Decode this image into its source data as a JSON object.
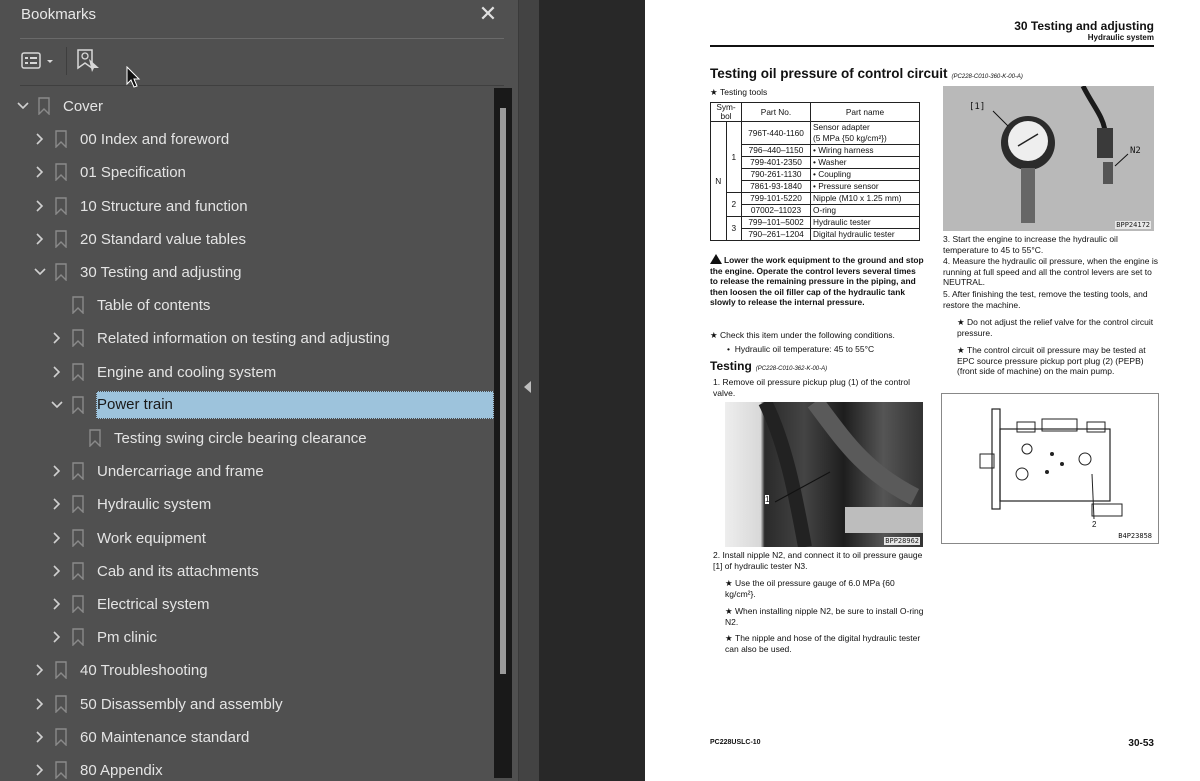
{
  "sidebar": {
    "title": "Bookmarks",
    "close_label": "✕",
    "toolbar": {
      "options_icon": "list-options-icon",
      "find_icon": "find-current-bookmark-icon"
    },
    "items": [
      {
        "label": "Cover",
        "level": 0,
        "state": "expanded"
      },
      {
        "label": "00 Index and foreword",
        "level": 1,
        "state": "collapsed"
      },
      {
        "label": "01 Specification",
        "level": 1,
        "state": "collapsed"
      },
      {
        "label": "10 Structure and function",
        "level": 1,
        "state": "collapsed"
      },
      {
        "label": "20 Standard value tables",
        "level": 1,
        "state": "collapsed"
      },
      {
        "label": "30 Testing and adjusting",
        "level": 1,
        "state": "expanded"
      },
      {
        "label": "Table of contents",
        "level": 2,
        "state": "leaf"
      },
      {
        "label": "Related information on testing and adjusting",
        "level": 2,
        "state": "collapsed"
      },
      {
        "label": "Engine and cooling system",
        "level": 2,
        "state": "collapsed"
      },
      {
        "label": "Power train",
        "level": 2,
        "state": "expanded",
        "selected": true
      },
      {
        "label": "Testing swing circle bearing clearance",
        "level": 3,
        "state": "leaf"
      },
      {
        "label": "Undercarriage and frame",
        "level": 2,
        "state": "collapsed"
      },
      {
        "label": "Hydraulic system",
        "level": 2,
        "state": "collapsed"
      },
      {
        "label": "Work equipment",
        "level": 2,
        "state": "collapsed"
      },
      {
        "label": "Cab and its attachments",
        "level": 2,
        "state": "collapsed"
      },
      {
        "label": "Electrical system",
        "level": 2,
        "state": "collapsed"
      },
      {
        "label": "Pm clinic",
        "level": 2,
        "state": "collapsed"
      },
      {
        "label": "40 Troubleshooting",
        "level": 1,
        "state": "collapsed"
      },
      {
        "label": "50 Disassembly and assembly",
        "level": 1,
        "state": "collapsed"
      },
      {
        "label": "60 Maintenance standard",
        "level": 1,
        "state": "collapsed"
      },
      {
        "label": "80 Appendix",
        "level": 1,
        "state": "collapsed"
      }
    ],
    "selected_color": "#9dc3dc"
  },
  "page": {
    "header_section": "30 Testing and adjusting",
    "header_subsection": "Hydraulic system",
    "title": "Testing oil pressure of control circuit",
    "title_code": "(PC228-C010-360-K-00-A)",
    "testing_tools_label": "Testing tools",
    "table": {
      "headers": [
        "Sym-bol",
        "Part No.",
        "Part name"
      ],
      "symbol": "N",
      "groups": [
        {
          "num": "1",
          "rows": [
            {
              "part_no": "796T-440-1160",
              "part_name": "Sensor adapter",
              "part_name2": "(5 MPa {50 kg/cm²})"
            },
            {
              "part_no": "796–440–1150",
              "part_name": "•  Wiring harness"
            },
            {
              "part_no": "799-401-2350",
              "part_name": "•  Washer"
            },
            {
              "part_no": "790-261-1130",
              "part_name": "•  Coupling"
            },
            {
              "part_no": "7861-93-1840",
              "part_name": "•  Pressure sensor"
            }
          ]
        },
        {
          "num": "2",
          "rows": [
            {
              "part_no": "799-101-5220",
              "part_name": "Nipple (M10 x 1.25 mm)"
            },
            {
              "part_no": "07002–11023",
              "part_name": "O-ring"
            }
          ]
        },
        {
          "num": "3",
          "rows": [
            {
              "part_no": "799–101–5002",
              "part_name": "Hydraulic tester"
            },
            {
              "part_no": "790–261–1204",
              "part_name": "Digital hydraulic tester"
            }
          ]
        }
      ]
    },
    "warning": "Lower the work equipment to the ground and stop the engine. Operate the control levers several times to release the remaining pressure in the piping, and then loosen the oil filler cap of the hydraulic tank slowly to release the internal pressure.",
    "check_note": "Check this item under the following conditions.",
    "check_bullet": "Hydraulic oil temperature: 45 to 55°C",
    "testing_heading": "Testing",
    "testing_code": "(PC228-C010-362-K-00-A)",
    "step1": "1. Remove oil pressure pickup plug (1) of the control valve.",
    "photo1_label": "BPP28962",
    "photo1_callout": "1",
    "step2": "2. Install nipple N2, and connect it to oil pressure gauge [1] of hydraulic tester N3.",
    "step2_notes": [
      "Use the oil pressure gauge of 6.0 MPa {60 kg/cm²}.",
      "When installing nipple N2, be sure to install O-ring N2.",
      "The nipple and hose of the digital hydraulic tester can also be used."
    ],
    "photo2_label": "BPP24172",
    "photo2_callouts": [
      "[1]",
      "N2"
    ],
    "step3": "3. Start the engine to increase the hydraulic oil temperature to 45 to 55°C.",
    "step4": "4. Measure the hydraulic oil pressure, when the engine is running at full speed and all the control levers are set to NEUTRAL.",
    "step5": "5. After finishing the test, remove the testing tools, and restore the machine.",
    "step5_notes": [
      "Do not adjust the relief valve for the control circuit pressure.",
      "The control circuit oil pressure may be tested at EPC source pressure pickup port plug (2) (PEPB) (front side of machine) on the main pump."
    ],
    "diagram_label": "B4P23858",
    "diagram_callout": "2",
    "footer_model": "PC228USLC-10",
    "footer_page": "30-53"
  }
}
